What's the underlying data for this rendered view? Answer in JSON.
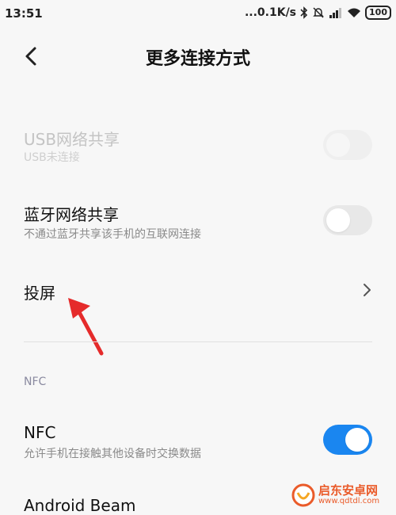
{
  "status_bar": {
    "time": "13:51",
    "network_speed": "...0.1K/s",
    "battery": "100"
  },
  "header": {
    "title": "更多连接方式"
  },
  "settings": {
    "usb_tethering": {
      "title": "USB网络共享",
      "subtitle": "USB未连接",
      "enabled": false,
      "on": false
    },
    "bluetooth_tethering": {
      "title": "蓝牙网络共享",
      "subtitle": "不通过蓝牙共享该手机的互联网连接",
      "on": false
    },
    "cast": {
      "title": "投屏"
    },
    "nfc_section": {
      "label": "NFC"
    },
    "nfc": {
      "title": "NFC",
      "subtitle": "允许手机在接触其他设备时交换数据",
      "on": true
    },
    "android_beam": {
      "title": "Android Beam"
    }
  },
  "watermark": {
    "brand": "启东安卓网",
    "url": "www.qdtdl.com"
  },
  "colors": {
    "accent": "#1a86f0",
    "annotation_arrow": "#e52b2b"
  }
}
